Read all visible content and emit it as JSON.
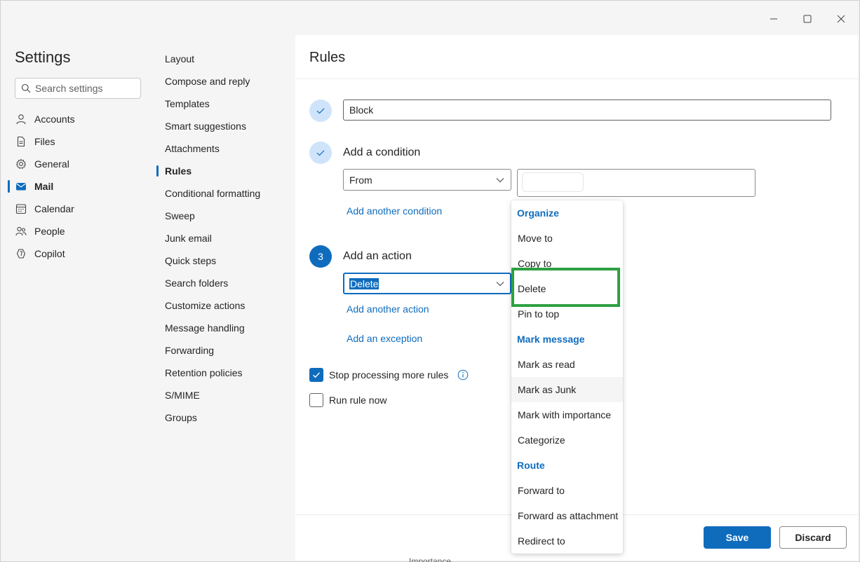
{
  "window": {
    "controls": {
      "minimize": "minimize-icon",
      "maximize": "maximize-icon",
      "close": "close-icon"
    }
  },
  "settings": {
    "title": "Settings",
    "search_placeholder": "Search settings"
  },
  "nav": {
    "items": [
      {
        "label": "Accounts",
        "icon": "person-icon"
      },
      {
        "label": "Files",
        "icon": "file-icon"
      },
      {
        "label": "General",
        "icon": "gear-icon"
      },
      {
        "label": "Mail",
        "icon": "mail-icon",
        "active": true
      },
      {
        "label": "Calendar",
        "icon": "calendar-icon"
      },
      {
        "label": "People",
        "icon": "people-icon"
      },
      {
        "label": "Copilot",
        "icon": "copilot-icon"
      }
    ]
  },
  "mail_settings": {
    "items": [
      "Layout",
      "Compose and reply",
      "Templates",
      "Smart suggestions",
      "Attachments",
      "Rules",
      "Conditional formatting",
      "Sweep",
      "Junk email",
      "Quick steps",
      "Search folders",
      "Customize actions",
      "Message handling",
      "Forwarding",
      "Retention policies",
      "S/MIME",
      "Groups"
    ],
    "active": "Rules"
  },
  "rules": {
    "title": "Rules",
    "rule_name": "Block",
    "condition": {
      "label": "Add a condition",
      "selected": "From",
      "add_link": "Add another condition"
    },
    "action": {
      "step_number": "3",
      "label": "Add an action",
      "selected": "Delete",
      "add_link": "Add another action"
    },
    "exception_link": "Add an exception",
    "stop_processing": {
      "label": "Stop processing more rules",
      "checked": true
    },
    "run_now": {
      "label": "Run rule now",
      "checked": false
    },
    "save_label": "Save",
    "discard_label": "Discard",
    "behind_text": "Importance"
  },
  "dropdown": {
    "sections": [
      {
        "header": "Organize",
        "items": [
          "Move to",
          "Copy to",
          "Delete",
          "Pin to top"
        ]
      },
      {
        "header": "Mark message",
        "items": [
          "Mark as read",
          "Mark as Junk",
          "Mark with importance",
          "Categorize"
        ]
      },
      {
        "header": "Route",
        "items": [
          "Forward to",
          "Forward as attachment",
          "Redirect to"
        ]
      }
    ],
    "hovered": "Mark as Junk",
    "highlighted": "Delete"
  },
  "colors": {
    "accent": "#0f6cbd",
    "highlight_box": "#2ea043"
  }
}
